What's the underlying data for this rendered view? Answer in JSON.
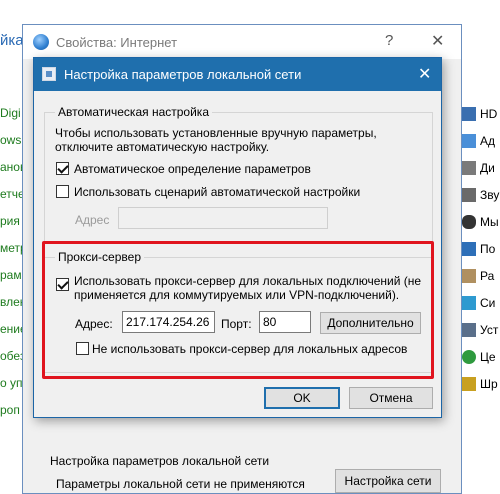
{
  "background": {
    "top_left_fragment": "йка",
    "left_items": [
      "Digi",
      "ows 1",
      "анов",
      "етчер",
      "рия о",
      "метр",
      "рамм",
      "вление",
      "ение",
      "обез",
      "о упр",
      "роп"
    ],
    "right_items": [
      {
        "label": "HD",
        "icon_color": "#3a6fb0"
      },
      {
        "label": "Ад",
        "icon_color": "#4a8fd8"
      },
      {
        "label": "Ди",
        "icon_color": "#7a7a7a"
      },
      {
        "label": "Зву",
        "icon_color": "#6a6a6a"
      },
      {
        "label": "Мы",
        "icon_color": "#333333"
      },
      {
        "label": "По",
        "icon_color": "#2d6fb8"
      },
      {
        "label": "Ра",
        "icon_color": "#b09060"
      },
      {
        "label": "Си",
        "icon_color": "#2e9ad0"
      },
      {
        "label": "Уст",
        "icon_color": "#5a6f8a"
      },
      {
        "label": "Це",
        "icon_color": "#2e9a3e"
      },
      {
        "label": "Шр",
        "icon_color": "#c8a020"
      }
    ]
  },
  "internet_props": {
    "title": "Свойства: Интернет",
    "help_glyph": "?",
    "close_glyph": "✕",
    "lan_section_title": "Настройка параметров локальной сети",
    "lan_section_text": "Параметры локальной сети не применяются",
    "lan_settings_button": "Настройка сети"
  },
  "lan_dialog": {
    "title": "Настройка параметров локальной сети",
    "close_glyph": "✕",
    "auto": {
      "legend": "Автоматическая настройка",
      "description_line1": "Чтобы использовать установленные вручную параметры,",
      "description_line2": "отключите автоматическую настройку.",
      "auto_detect_label": "Автоматическое определение параметров",
      "auto_detect_checked": true,
      "use_script_label": "Использовать сценарий автоматической настройки",
      "use_script_checked": false,
      "address_label": "Адрес",
      "address_value": ""
    },
    "proxy": {
      "legend": "Прокси-сервер",
      "use_proxy_label_line1": "Использовать прокси-сервер для локальных подключений (не",
      "use_proxy_label_line2": "применяется для коммутируемых или VPN-подключений).",
      "use_proxy_checked": true,
      "address_label": "Адрес:",
      "address_value": "217.174.254.26",
      "port_label": "Порт:",
      "port_value": "80",
      "advanced_button": "Дополнительно",
      "bypass_local_label": "Не использовать прокси-сервер для локальных адресов",
      "bypass_local_checked": false
    },
    "ok_button": "OK",
    "cancel_button": "Отмена"
  },
  "highlight_color": "#e0141e"
}
